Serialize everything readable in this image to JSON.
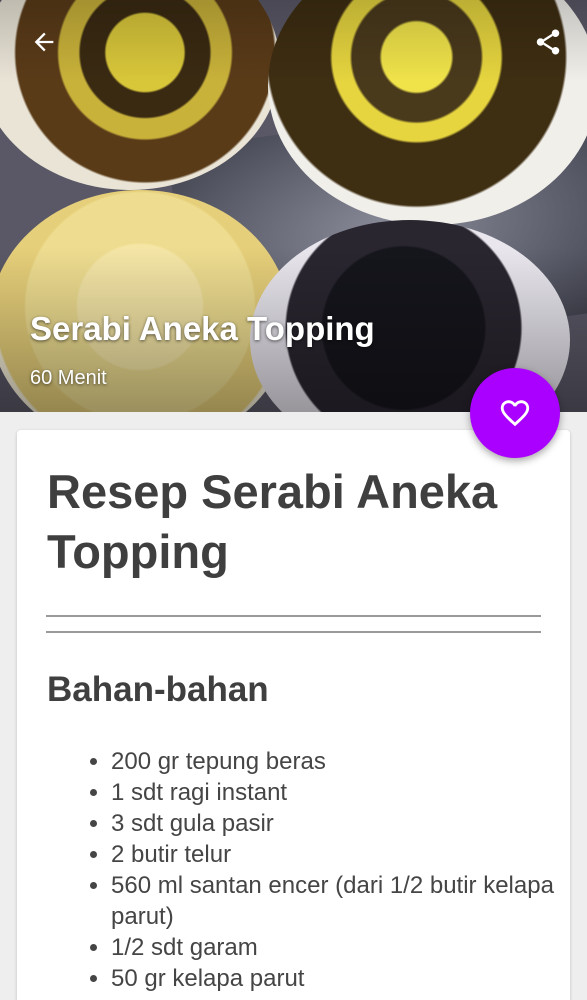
{
  "hero": {
    "title": "Serabi Aneka Topping",
    "time": "60 Menit"
  },
  "toolbar": {
    "back_icon": "arrow-back-icon",
    "share_icon": "share-icon"
  },
  "favorite": {
    "icon": "heart-outline-icon",
    "color": "#aa00ff"
  },
  "recipe": {
    "title": "Resep Serabi Aneka Topping",
    "ingredients_heading": "Bahan-bahan",
    "ingredients": [
      "200 gr tepung beras",
      "1 sdt ragi instant",
      "3 sdt gula pasir",
      "2 butir telur",
      "560 ml santan encer (dari 1/2 butir kelapa parut)",
      "1/2 sdt garam",
      "50 gr kelapa parut"
    ]
  }
}
